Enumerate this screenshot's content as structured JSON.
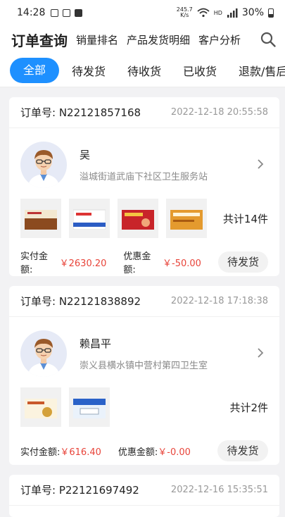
{
  "status_bar": {
    "time": "14:28",
    "speed_value": "245.7",
    "speed_unit": "K/s",
    "hd": "HD",
    "net": "5G",
    "battery": "30%"
  },
  "nav": {
    "items": [
      "订单查询",
      "销量排名",
      "产品发货明细",
      "客户分析"
    ]
  },
  "tabs": [
    "全部",
    "待发货",
    "待收货",
    "已收货",
    "退款/售后"
  ],
  "labels": {
    "order_no": "订单号: ",
    "paid": "实付金额: ",
    "discount": "优惠金额: "
  },
  "orders": [
    {
      "order_no": "N22121857168",
      "time": "2022-12-18 20:55:58",
      "customer_name": "吴",
      "customer_addr": "溢城街道武庙下社区卫生服务站",
      "product_count": 4,
      "total_text": "共计14件",
      "paid": "￥2630.20",
      "discount": "￥-50.00",
      "status": "待发货"
    },
    {
      "order_no": "N22121838892",
      "time": "2022-12-18 17:18:38",
      "customer_name": "赖昌平",
      "customer_addr": "崇义县横水镇中营村第四卫生室",
      "product_count": 2,
      "total_text": "共计2件",
      "paid": "￥616.40",
      "discount": "￥-0.00",
      "status": "待发货"
    },
    {
      "order_no": "P22121697492",
      "time": "2022-12-16 15:35:51"
    }
  ],
  "colors": {
    "accent": "#1e90ff",
    "price": "#e8443a"
  }
}
